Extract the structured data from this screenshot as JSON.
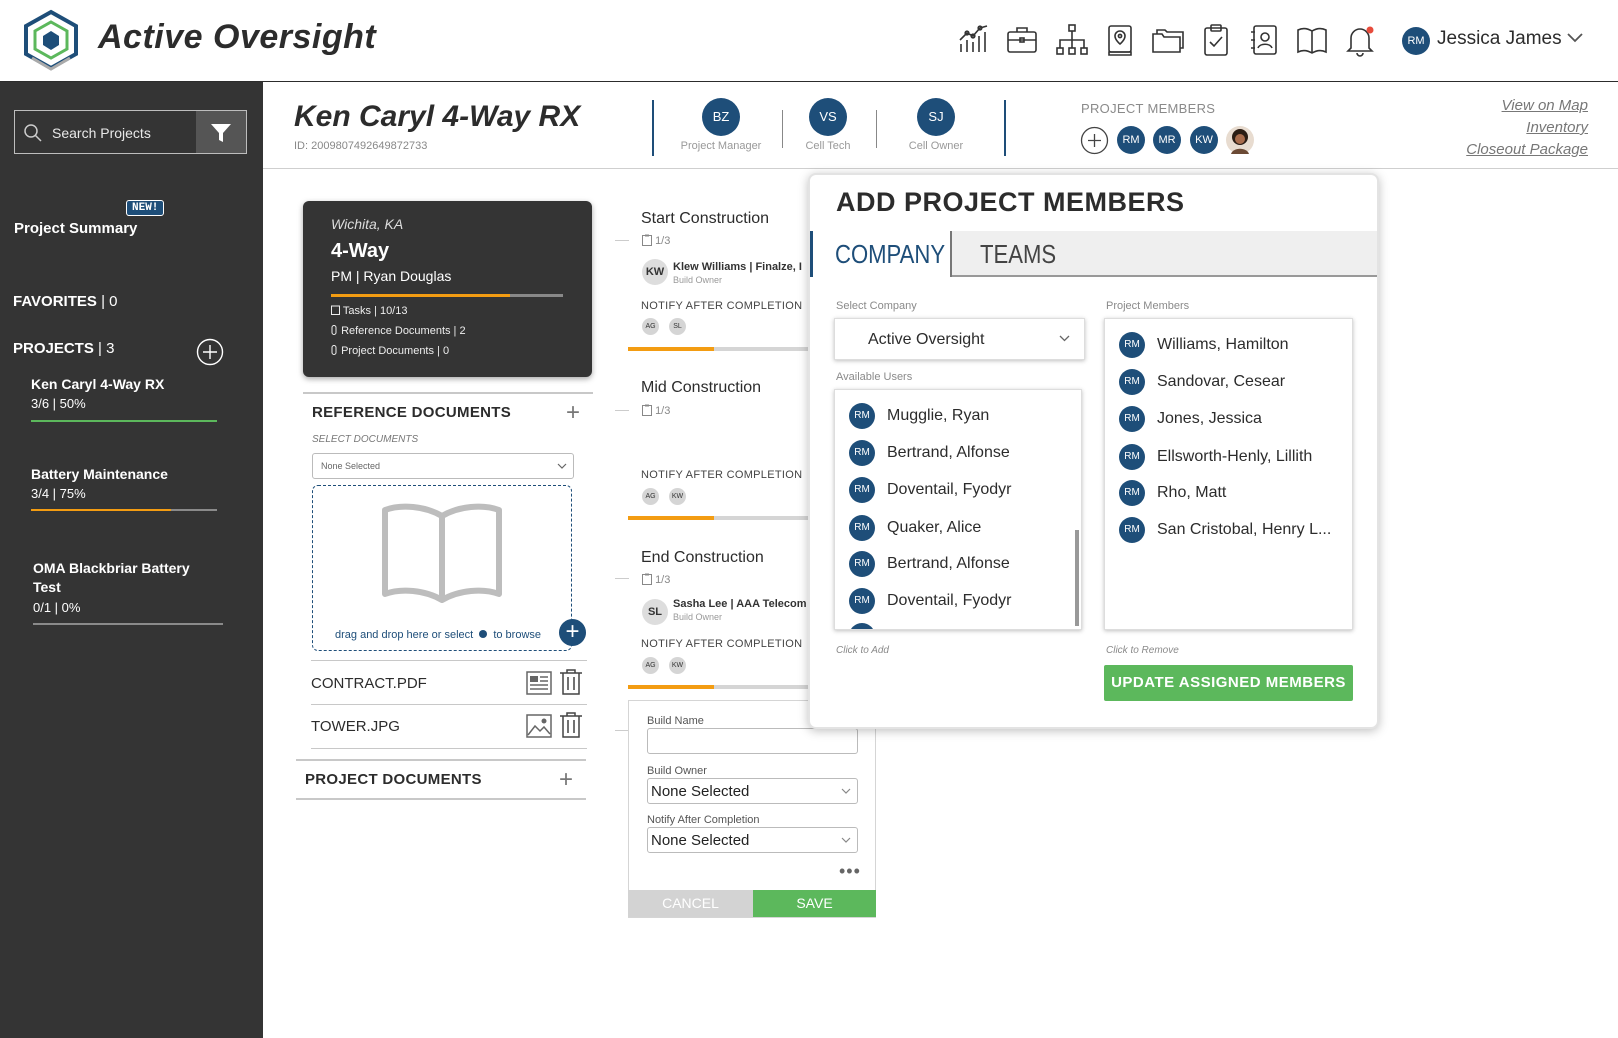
{
  "app": {
    "brand": "Active Oversight",
    "user": {
      "initials": "RM",
      "name": "Jessica James"
    },
    "nav_icons": [
      "analytics-icon",
      "briefcase-icon",
      "org-chart-icon",
      "map-pin-icon",
      "folders-icon",
      "clipboard-check-icon",
      "contact-card-icon",
      "book-icon",
      "bell-icon"
    ]
  },
  "sidebar": {
    "search_placeholder": "Search Projects",
    "project_summary": "Project Summary",
    "new_badge": "NEW!",
    "favorites": "FAVORITES",
    "favorites_count": "| 0",
    "projects": "PROJECTS",
    "projects_count": "| 3",
    "items": [
      {
        "name": "Ken Caryl 4-Way RX",
        "stat": "3/6  | 50%",
        "progress": 1.0,
        "color": "#5cb85c"
      },
      {
        "name": "Battery Maintenance",
        "stat": "3/4  | 75%",
        "progress": 0.75,
        "color": "#f39c12"
      },
      {
        "name": "OMA Blackbriar Battery Test",
        "stat": "0/1  | 0%",
        "progress": 0.0,
        "color": "#f39c12"
      }
    ]
  },
  "header": {
    "title": "Ken Caryl 4-Way RX",
    "id": "ID: 2009807492649872733",
    "roles": [
      {
        "initials": "BZ",
        "label": "Project Manager"
      },
      {
        "initials": "VS",
        "label": "Cell Tech"
      },
      {
        "initials": "SJ",
        "label": "Cell Owner"
      }
    ],
    "members_heading": "PROJECT MEMBERS",
    "members": [
      "RM",
      "MR",
      "KW"
    ],
    "links": [
      "View on Map",
      "Inventory",
      "Closeout Package"
    ]
  },
  "card": {
    "location": "Wichita, KA",
    "type": "4-Way",
    "pm": "PM | Ryan Douglas",
    "progress": 0.77,
    "tasks": "Tasks  |  10/13",
    "ref_docs": "Reference Documents  |  2",
    "proj_docs": "Project Documents     |  0"
  },
  "ref_docs": {
    "title": "REFERENCE DOCUMENTS",
    "select_label": "SELECT DOCUMENTS",
    "select_value": "None Selected",
    "drop_text": "drag and drop here or select",
    "browse_text": "to browse",
    "files": [
      "CONTRACT.PDF",
      "TOWER.JPG"
    ]
  },
  "proj_docs": {
    "title": "PROJECT DOCUMENTS"
  },
  "tasks": [
    {
      "title": "Start Construction",
      "count": "1/3",
      "owner_initials": "KW",
      "owner_name": "Klew Williams  |  Finalze, I",
      "owner_role": "Build Owner",
      "notify": "NOTIFY AFTER COMPLETION",
      "notify_avatars": [
        "AG",
        "SL"
      ],
      "progress": 0.48
    },
    {
      "title": "Mid Construction",
      "count": "1/3",
      "notify": "NOTIFY AFTER COMPLETION",
      "notify_avatars": [
        "AG",
        "KW"
      ],
      "progress": 0.48
    },
    {
      "title": "End Construction",
      "count": "1/3",
      "owner_initials": "SL",
      "owner_name": "Sasha Lee  |  AAA Telecom",
      "owner_role": "Build Owner",
      "notify": "NOTIFY AFTER COMPLETION",
      "notify_avatars": [
        "AG",
        "KW"
      ],
      "progress": 0.48
    }
  ],
  "build_form": {
    "build_name_label": "Build Name",
    "build_owner_label": "Build Owner",
    "build_owner_value": "None Selected",
    "notify_label": "Notify After Completion",
    "notify_value": "None Selected",
    "more": "•••",
    "cancel": "CANCEL",
    "save": "SAVE"
  },
  "modal": {
    "title": "ADD PROJECT MEMBERS",
    "tabs": [
      "COMPANY",
      "TEAMS"
    ],
    "select_company_label": "Select Company",
    "company_value": "Active Oversight",
    "available_label": "Available Users",
    "members_label": "Project Members",
    "available_users": [
      "Mugglie, Ryan",
      "Bertrand, Alfonse",
      "Doventail, Fyodyr",
      "Quaker, Alice",
      "Bertrand, Alfonse",
      "Doventail, Fyodyr"
    ],
    "project_members": [
      "Williams, Hamilton",
      "Sandovar, Cesear",
      "Jones, Jessica",
      "Ellsworth-Henly, Lillith",
      "Rho, Matt",
      "San Cristobal, Henry L..."
    ],
    "avatar_initials": "RM",
    "click_to_add": "Click to Add",
    "click_to_remove": "Click to Remove",
    "update_button": "UPDATE ASSIGNED MEMBERS"
  }
}
